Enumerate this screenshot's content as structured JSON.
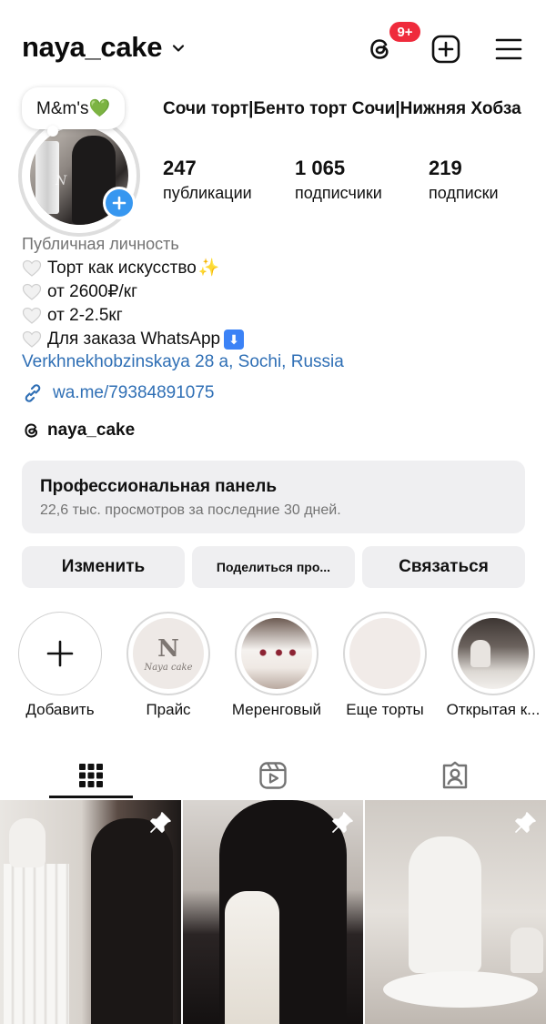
{
  "header": {
    "username": "naya_cake",
    "notification_badge": "9+",
    "icons": [
      "chevron-down-icon",
      "threads-icon",
      "add-post-icon",
      "menu-icon"
    ]
  },
  "profile": {
    "note": "M&m's💚",
    "full_name": "Сочи торт|Бенто торт Сочи|Нижняя Хобза",
    "stats": [
      {
        "value": "247",
        "label": "публикации"
      },
      {
        "value": "1 065",
        "label": "подписчики"
      },
      {
        "value": "219",
        "label": "подписки"
      }
    ],
    "category": "Публичная личность",
    "bio_lines": [
      {
        "text": "Торт как искусство",
        "suffix": "✨"
      },
      {
        "text": "от 2600₽/кг",
        "suffix": ""
      },
      {
        "text": "от 2-2.5кг",
        "suffix": ""
      },
      {
        "text": "Для заказа WhatsApp",
        "suffix": "⬇"
      }
    ],
    "address": "Verkhnekhobzinskaya 28 a, Sochi, Russia",
    "link": "wa.me/79384891075",
    "threads_handle": "naya_cake"
  },
  "pro_panel": {
    "title": "Профессиональная панель",
    "subtitle": "22,6 тыс. просмотров за последние 30 дней."
  },
  "actions": {
    "edit": "Изменить",
    "share": "Поделиться про...",
    "contact": "Связаться"
  },
  "highlights": [
    {
      "label": "Добавить"
    },
    {
      "label": "Прайс",
      "logo_text": "N",
      "logo_sub": "Naya cake"
    },
    {
      "label": "Меренговый"
    },
    {
      "label": "Еще торты"
    },
    {
      "label": "Открытая к..."
    }
  ],
  "tabs": [
    "grid-icon",
    "reels-icon",
    "tagged-icon"
  ],
  "colors": {
    "accent_blue": "#3797f0",
    "link_blue": "#2f6fb5",
    "badge_red": "#ef2b3c",
    "panel_gray": "#efeff1"
  }
}
